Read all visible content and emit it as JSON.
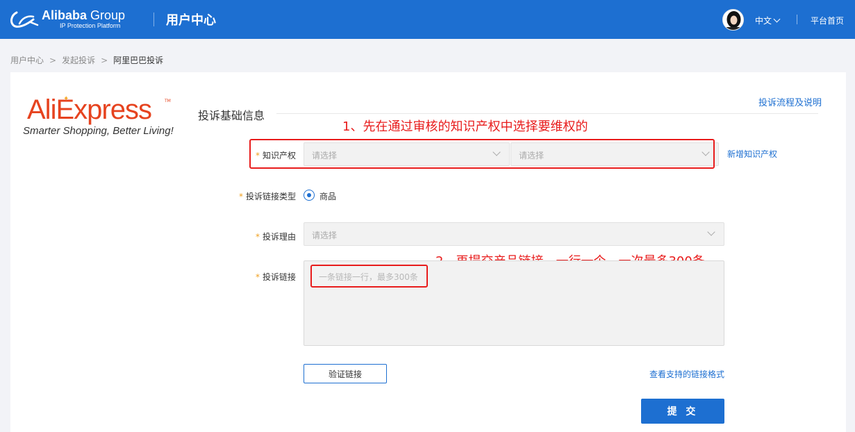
{
  "header": {
    "brand_name": "Alibaba",
    "brand_group": " Group",
    "brand_sub": "IP Protection Platform",
    "title": "用户中心",
    "language": "中文",
    "home_link": "平台首页"
  },
  "breadcrumb": {
    "items": [
      "用户中心",
      "发起投诉",
      "阿里巴巴投诉"
    ],
    "separator": ">"
  },
  "brand_logo": {
    "name": "AliExpress",
    "slogan": "Smarter Shopping, Better Living!",
    "tm": "TM"
  },
  "section": {
    "title": "投诉基础信息",
    "flow_link": "投诉流程及说明"
  },
  "annotations": {
    "step1": "1、先在通过审核的知识产权中选择要维权的",
    "step2": "2、再提交产品链接，一行一个，一次最多300条"
  },
  "form": {
    "required_mark": "*",
    "ip": {
      "label": "知识产权",
      "select1_placeholder": "请选择",
      "select2_placeholder": "请选择",
      "add_link": "新增知识产权"
    },
    "link_type": {
      "label": "投诉链接类型",
      "option": "商品"
    },
    "reason": {
      "label": "投诉理由",
      "placeholder": "请选择"
    },
    "links": {
      "label": "投诉链接",
      "placeholder": "一条链接一行，最多300条"
    },
    "verify_button": "验证链接",
    "formats_link": "查看支持的链接格式",
    "submit_button": "提 交"
  },
  "colors": {
    "brand_blue": "#1d6fd1",
    "annotation_red": "#e81c1c",
    "aliexpress_orange": "#e6431f",
    "required_orange": "#f0a020"
  }
}
